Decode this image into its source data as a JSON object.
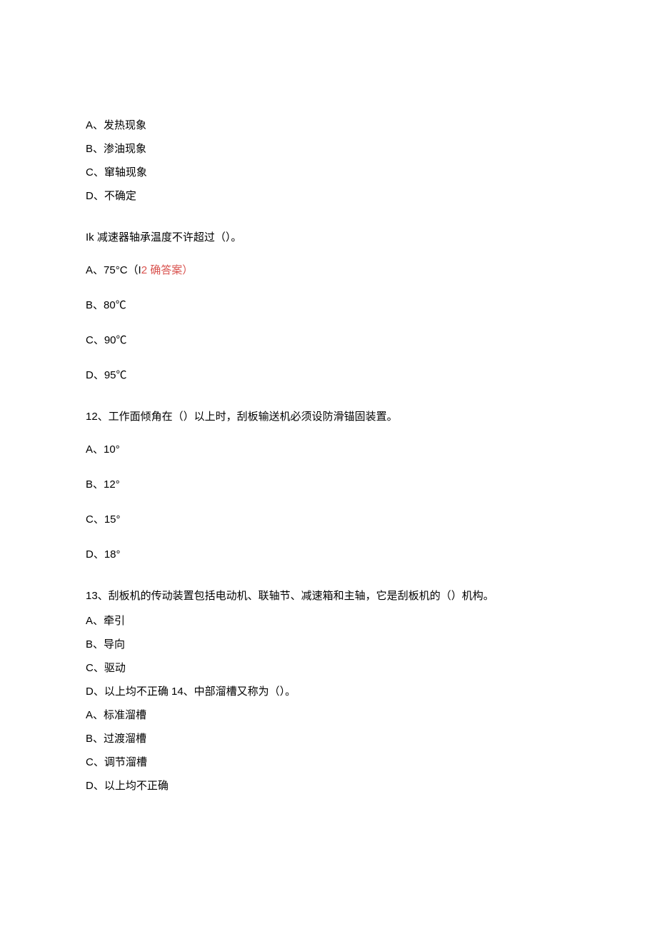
{
  "q10_options": {
    "a": "A、发热现象",
    "b": "B、渗油现象",
    "c": "C、窜轴现象",
    "d": "D、不确定"
  },
  "q11": {
    "stem": "Ik 减速器轴承温度不许超过（）。",
    "a_prefix": "A、75°C（I",
    "a_correct": "2 确答案）",
    "b": "B、80℃",
    "c": "C、90℃",
    "d": "D、95℃"
  },
  "q12": {
    "stem": "12、工作面倾角在（）以上时，刮板输送机必须设防滑锚固装置。",
    "a": "A、10°",
    "b": "B、12°",
    "c": "C、15°",
    "d": "D、18°"
  },
  "q13": {
    "stem": "13、刮板机的传动装置包括电动机、联轴节、减速箱和主轴，它是刮板机的（）机构。",
    "a": "A、牵引",
    "b": "B、导向",
    "c": "C、驱动",
    "d_and_q14": "D、以上均不正确 14、中部溜槽又称为（）。"
  },
  "q14": {
    "a": "A、标准溜槽",
    "b": "B、过渡溜槽",
    "c": "C、调节溜槽",
    "d": "D、以上均不正确"
  }
}
